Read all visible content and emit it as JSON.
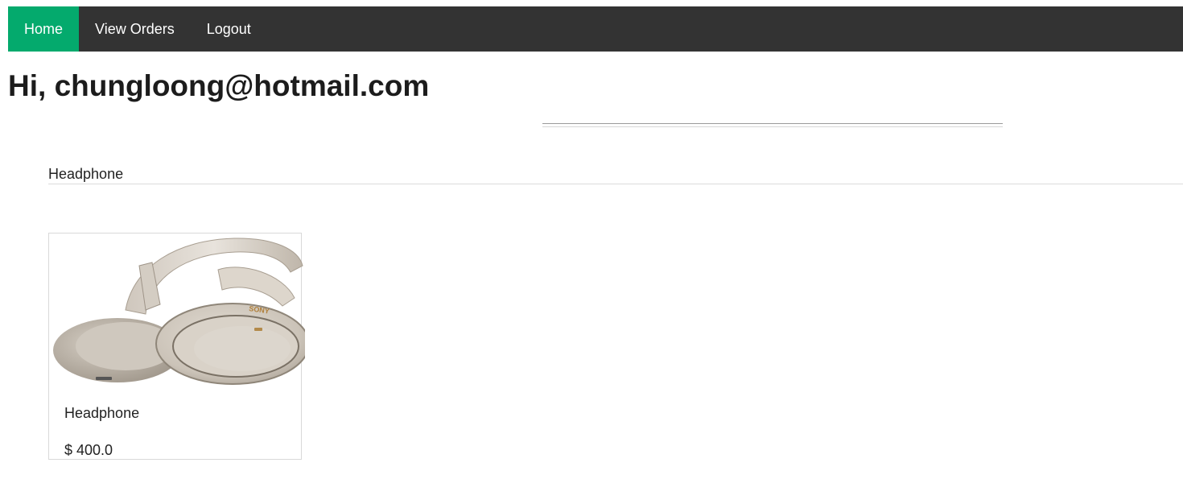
{
  "nav": {
    "items": [
      {
        "label": "Home",
        "active": true
      },
      {
        "label": "View Orders",
        "active": false
      },
      {
        "label": "Logout",
        "active": false
      }
    ],
    "bg_color": "#333333",
    "active_color": "#04aa6d"
  },
  "greeting": {
    "prefix": "Hi,",
    "email": "chungloong@hotmail.com"
  },
  "search": {
    "value": ""
  },
  "category": {
    "title": "Headphone"
  },
  "products": [
    {
      "name": "Headphone",
      "currency": "$",
      "price": "400.0",
      "image_icon": "headphone-image",
      "image_brand_text": "SONY"
    }
  ]
}
